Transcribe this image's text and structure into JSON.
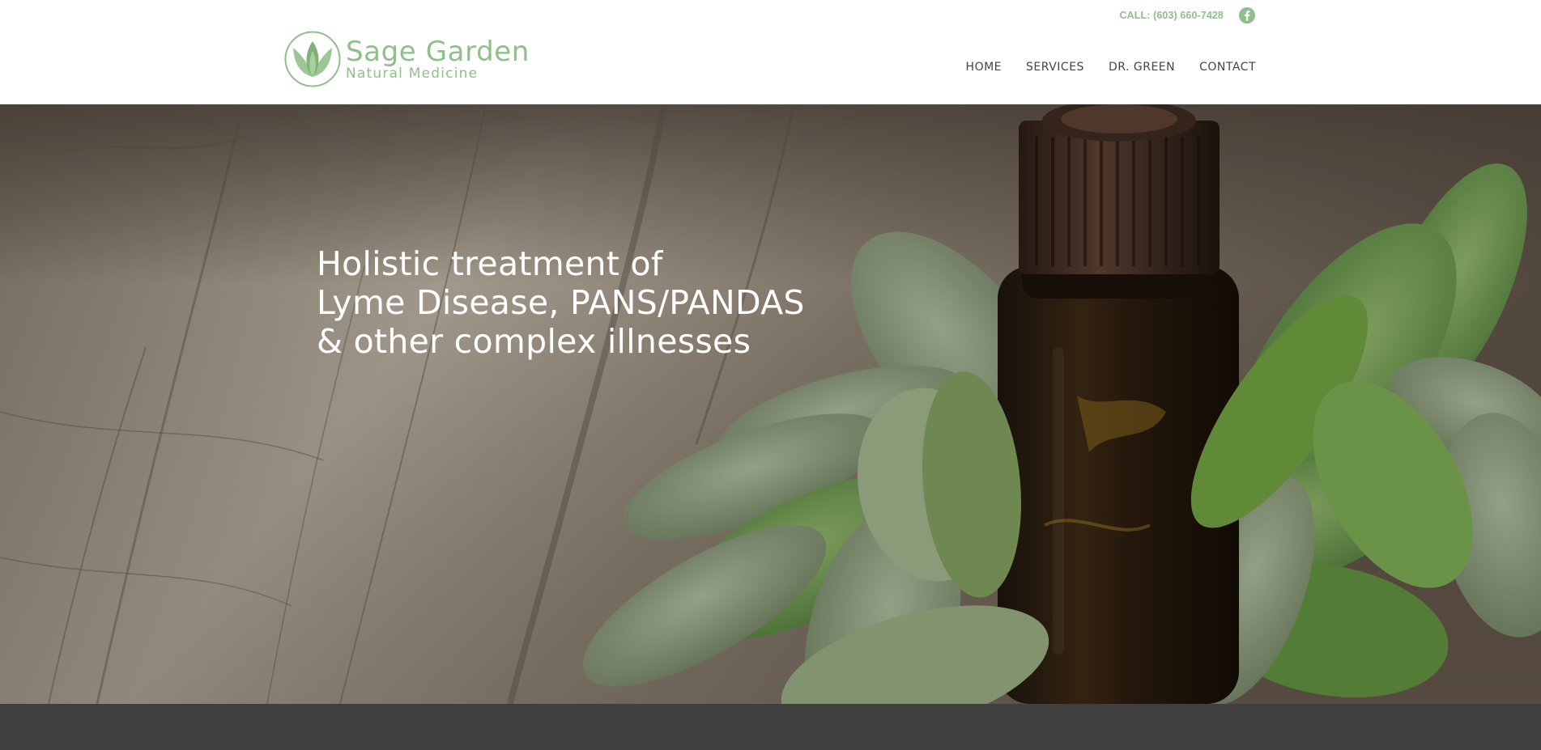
{
  "brand": {
    "name": "Sage Garden",
    "tagline": "Natural Medicine",
    "color": "#8fbf8a"
  },
  "topbar": {
    "phone_label": "CALL: (603) 660-7428",
    "social_icon": "facebook-icon"
  },
  "nav": {
    "items": [
      {
        "label": "HOME"
      },
      {
        "label": "SERVICES"
      },
      {
        "label": "DR. GREEN"
      },
      {
        "label": "CONTACT"
      }
    ]
  },
  "hero": {
    "title_lines": [
      "Holistic treatment of",
      "Lyme Disease, PANS/PANDAS",
      "& other complex illnesses"
    ],
    "image": "essential oil bottle with sage leaves on wooden table"
  },
  "footer_band": {
    "color": "#3f3f3f"
  }
}
